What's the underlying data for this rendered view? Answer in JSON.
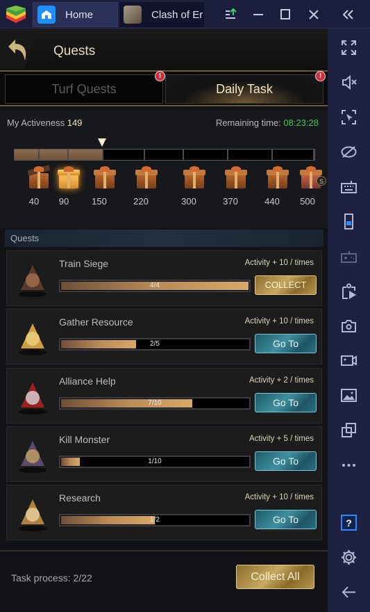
{
  "titlebar": {
    "tabs": [
      {
        "label": "Home",
        "icon": "home-icon"
      },
      {
        "label": "Clash of Er",
        "icon": "game-thumbnail"
      }
    ],
    "controls": [
      "upload-apk-icon",
      "minimize-icon",
      "maximize-icon",
      "close-icon",
      "collapse-sidebar-icon"
    ]
  },
  "header": {
    "title": "Quests",
    "back_icon": "back-arrow-icon"
  },
  "tabs": [
    {
      "label": "Turf Quests",
      "active": false,
      "alert": "!"
    },
    {
      "label": "Daily Task",
      "active": true,
      "alert": "!"
    }
  ],
  "activeness": {
    "label": "My Activeness",
    "value": "149",
    "remaining_label": "Remaining time:",
    "remaining_time": "08:23:28",
    "current": 149,
    "max": 500,
    "tiers": [
      "40",
      "90",
      "150",
      "220",
      "300",
      "370",
      "440",
      "500"
    ]
  },
  "quests": {
    "section_title": "Quests",
    "items": [
      {
        "name": "Train Siege",
        "activity": "Activity + 10 / times",
        "progress": "4/4",
        "fraction": 1.0,
        "button": "COLLECT",
        "button_type": "collect"
      },
      {
        "name": "Gather Resource",
        "activity": "Activity + 10 / times",
        "progress": "2/5",
        "fraction": 0.4,
        "button": "Go To",
        "button_type": "goto"
      },
      {
        "name": "Alliance Help",
        "activity": "Activity + 2 / times",
        "progress": "7/10",
        "fraction": 0.7,
        "button": "Go To",
        "button_type": "goto"
      },
      {
        "name": "Kill Monster",
        "activity": "Activity + 5 / times",
        "progress": "1/10",
        "fraction": 0.1,
        "button": "Go To",
        "button_type": "goto"
      },
      {
        "name": "Research",
        "activity": "Activity + 10 / times",
        "progress": "1/2",
        "fraction": 0.5,
        "button": "Go To",
        "button_type": "goto"
      }
    ]
  },
  "footer": {
    "task_process": "Task process: 2/22",
    "collect_all": "Collect All"
  },
  "sidebar": {
    "icons": [
      "fullscreen-icon",
      "mute-icon",
      "screen-select-icon",
      "eye-slash-icon",
      "keyboard-icon",
      "phone-rotate-icon",
      "gamepad-icon",
      "apk-install-icon",
      "camera-icon",
      "video-record-icon",
      "gallery-icon",
      "multi-instance-icon",
      "more-icon",
      "help-icon",
      "settings-icon",
      "back-icon"
    ]
  }
}
